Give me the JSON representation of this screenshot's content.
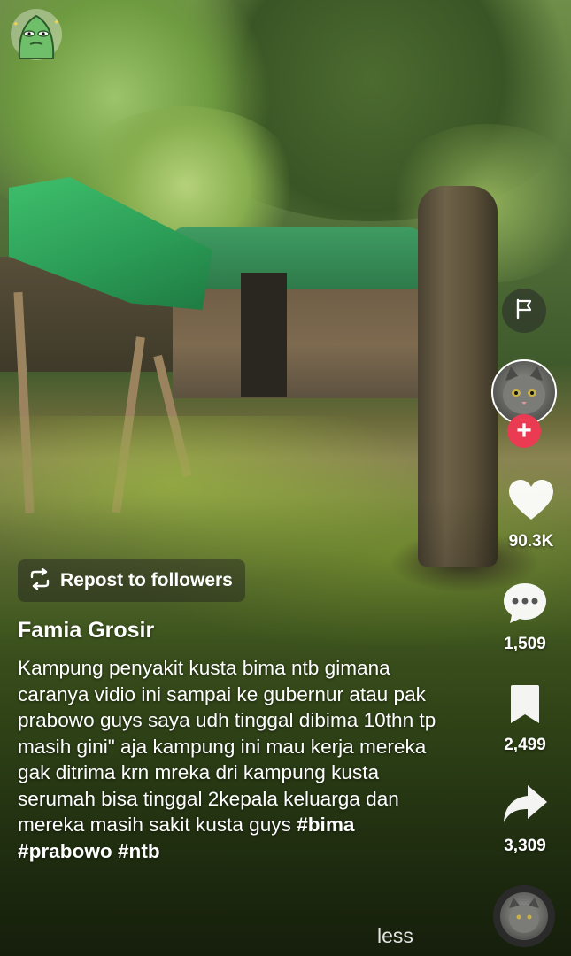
{
  "overlay": {
    "repost_label": "Repost to followers",
    "author_name": "Famia Grosir",
    "caption_text": "Kampung penyakit kusta bima ntb gimana caranya vidio ini sampai ke gubernur atau pak prabowo guys saya udh tinggal dibima 10thn tp masih gini\" aja kampung ini mau kerja mereka gak ditrima krn mreka dri kampung kusta serumah bisa tinggal 2kepala keluarga dan mereka masih sakit kusta guys",
    "hashtags": [
      "#bima",
      "#prabowo",
      "#ntb"
    ],
    "less_label": "less"
  },
  "actions": {
    "likes": "90.3K",
    "comments": "1,509",
    "saves": "2,499",
    "shares": "3,309"
  },
  "icons": {
    "sticker": "green-monster-sticker-icon",
    "report": "flag-icon",
    "follow": "plus-icon",
    "like": "heart-icon",
    "comment": "comment-bubble-icon",
    "save": "bookmark-icon",
    "share": "share-arrow-icon",
    "repost": "repost-arrows-icon",
    "music": "music-disc-icon"
  },
  "colors": {
    "follow_badge": "#ea3b53",
    "text": "#ffffff"
  }
}
